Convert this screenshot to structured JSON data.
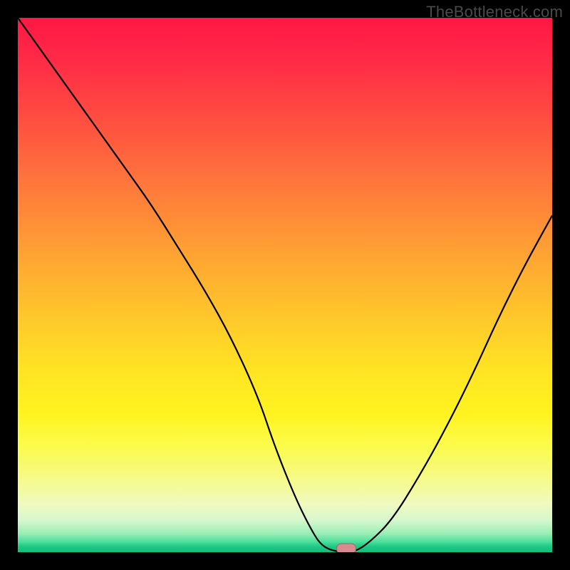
{
  "watermark": "TheBottleneck.com",
  "chart_data": {
    "type": "line",
    "title": "",
    "xlabel": "",
    "ylabel": "",
    "xlim": [
      0,
      100
    ],
    "ylim": [
      0,
      100
    ],
    "x": [
      0,
      5,
      10,
      15,
      20,
      25,
      30,
      35,
      40,
      45,
      48,
      52,
      55,
      57,
      60,
      63,
      66,
      70,
      75,
      80,
      85,
      90,
      95,
      100
    ],
    "values": [
      100,
      93,
      86,
      79,
      72,
      65,
      57,
      49,
      40,
      29,
      20,
      10,
      4,
      1,
      0,
      0,
      2,
      6,
      14,
      23,
      33,
      44,
      54,
      63
    ],
    "minimum_marker": {
      "x": 61.5,
      "y": 0
    },
    "gradient": {
      "top_color": "#ff1745",
      "mid_color": "#ffe423",
      "bottom_color": "#0fbf7f"
    }
  }
}
